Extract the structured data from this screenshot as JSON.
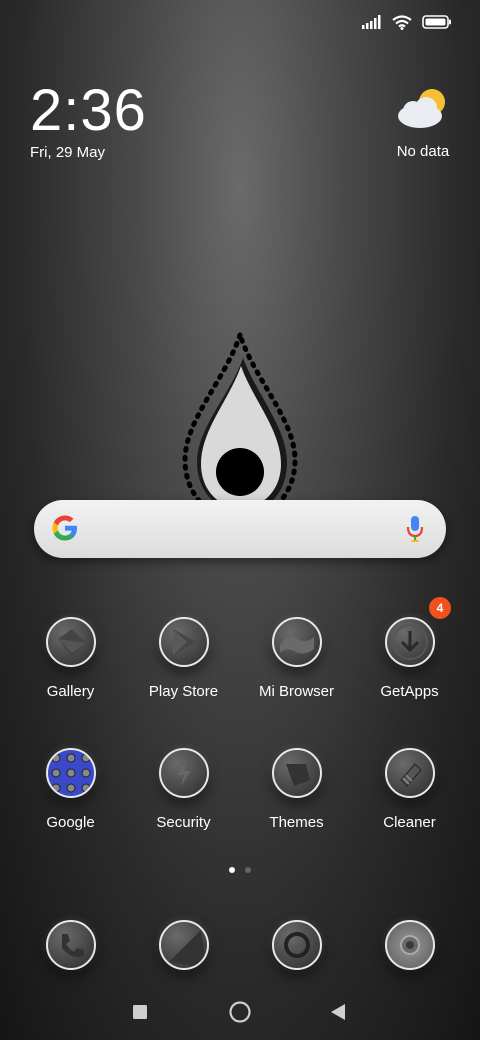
{
  "status_bar": {
    "signal_icon": "signal-icon",
    "wifi_icon": "wifi-icon",
    "battery_icon": "battery-icon"
  },
  "clock": {
    "time": "2:36",
    "date": "Fri, 29 May"
  },
  "weather": {
    "icon": "partly-cloudy-icon",
    "label": "No data"
  },
  "search": {
    "logo": "google-g-icon",
    "mic": "mic-icon"
  },
  "apps_row1": [
    {
      "label": "Gallery",
      "icon": "gallery-icon"
    },
    {
      "label": "Play Store",
      "icon": "play-store-icon"
    },
    {
      "label": "Mi Browser",
      "icon": "browser-icon"
    },
    {
      "label": "GetApps",
      "icon": "download-icon",
      "badge": "4"
    }
  ],
  "apps_row2": [
    {
      "label": "Google",
      "icon": "google-folder-icon"
    },
    {
      "label": "Security",
      "icon": "security-icon"
    },
    {
      "label": "Themes",
      "icon": "themes-icon"
    },
    {
      "label": "Cleaner",
      "icon": "cleaner-icon"
    }
  ],
  "dock": [
    {
      "icon": "phone-icon"
    },
    {
      "icon": "messages-icon"
    },
    {
      "icon": "chrome-icon"
    },
    {
      "icon": "camera-icon"
    }
  ],
  "page_indicator": {
    "pages": 2,
    "active": 1
  },
  "nav": {
    "recents": "recents-icon",
    "home": "home-icon",
    "back": "back-icon"
  },
  "colors": {
    "badge": "#f2501e",
    "google_folder": "#3a49c9"
  }
}
